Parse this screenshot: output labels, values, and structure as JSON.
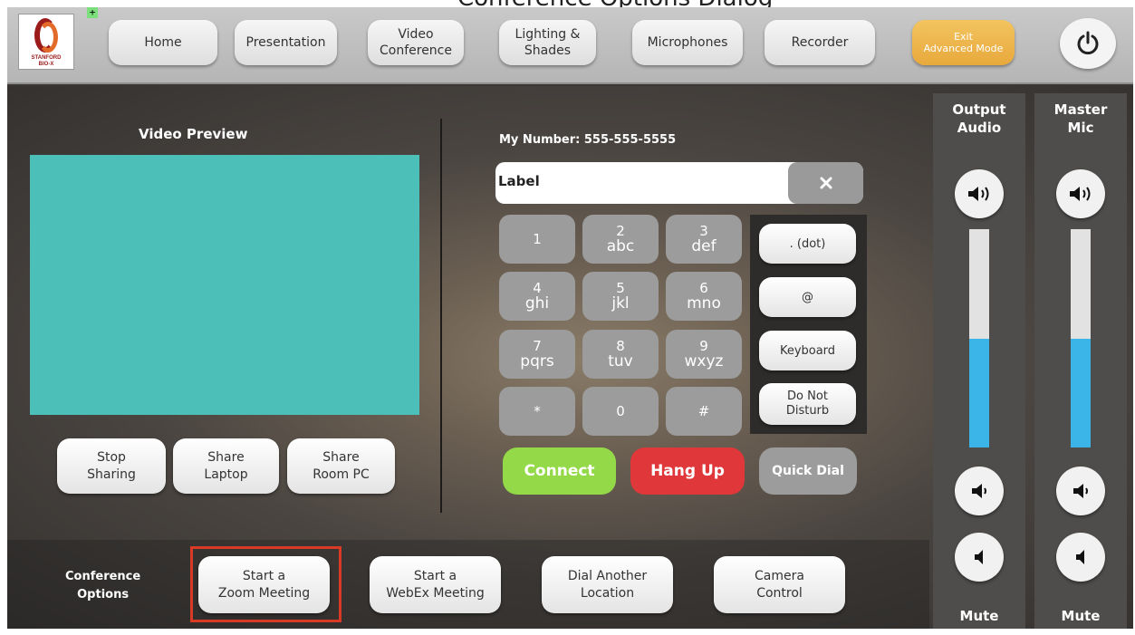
{
  "top_caption": "Conference Options Dialog",
  "logo": {
    "line1": "STANFORD",
    "line2": "BIO-X"
  },
  "plus_tag": "+",
  "nav": {
    "home": "Home",
    "presentation": "Presentation",
    "video_conference": "Video\nConference",
    "lighting": "Lighting &\nShades",
    "microphones": "Microphones",
    "recorder": "Recorder",
    "exit": "Exit\nAdvanced Mode",
    "power_icon": "power-icon"
  },
  "video": {
    "title": "Video Preview",
    "stop_sharing": "Stop\nSharing",
    "share_laptop": "Share\nLaptop",
    "share_room_pc": "Share\nRoom PC"
  },
  "dialer": {
    "my_number": "My Number: 555-555-5555",
    "input_value": "Label",
    "keys": [
      {
        "digit": "1",
        "letters": ""
      },
      {
        "digit": "2",
        "letters": "abc"
      },
      {
        "digit": "3",
        "letters": "def"
      },
      {
        "digit": "4",
        "letters": "ghi"
      },
      {
        "digit": "5",
        "letters": "jkl"
      },
      {
        "digit": "6",
        "letters": "mno"
      },
      {
        "digit": "7",
        "letters": "pqrs"
      },
      {
        "digit": "8",
        "letters": "tuv"
      },
      {
        "digit": "9",
        "letters": "wxyz"
      },
      {
        "digit": "*",
        "letters": ""
      },
      {
        "digit": "0",
        "letters": ""
      },
      {
        "digit": "#",
        "letters": ""
      }
    ],
    "dot": ". (dot)",
    "at": "@",
    "keyboard": "Keyboard",
    "dnd": "Do Not\nDisturb",
    "connect": "Connect",
    "hang_up": "Hang Up",
    "quick_dial": "Quick Dial"
  },
  "conference": {
    "label": "Conference\nOptions",
    "zoom": "Start a\nZoom Meeting",
    "webex": "Start a\nWebEx Meeting",
    "dial_another": "Dial Another\nLocation",
    "camera": "Camera\nControl"
  },
  "audio": {
    "output": {
      "title": "Output\nAudio",
      "level_percent": 50,
      "mute_label": "Mute"
    },
    "master": {
      "title": "Master\nMic",
      "level_percent": 50,
      "mute_label": "Mute"
    }
  },
  "colors": {
    "preview": "#4dbfb9",
    "connect": "#93d948",
    "hang_up": "#e0383a",
    "exit": "#e8a93c",
    "level": "#3bb5e8",
    "highlight": "#d93a26"
  }
}
